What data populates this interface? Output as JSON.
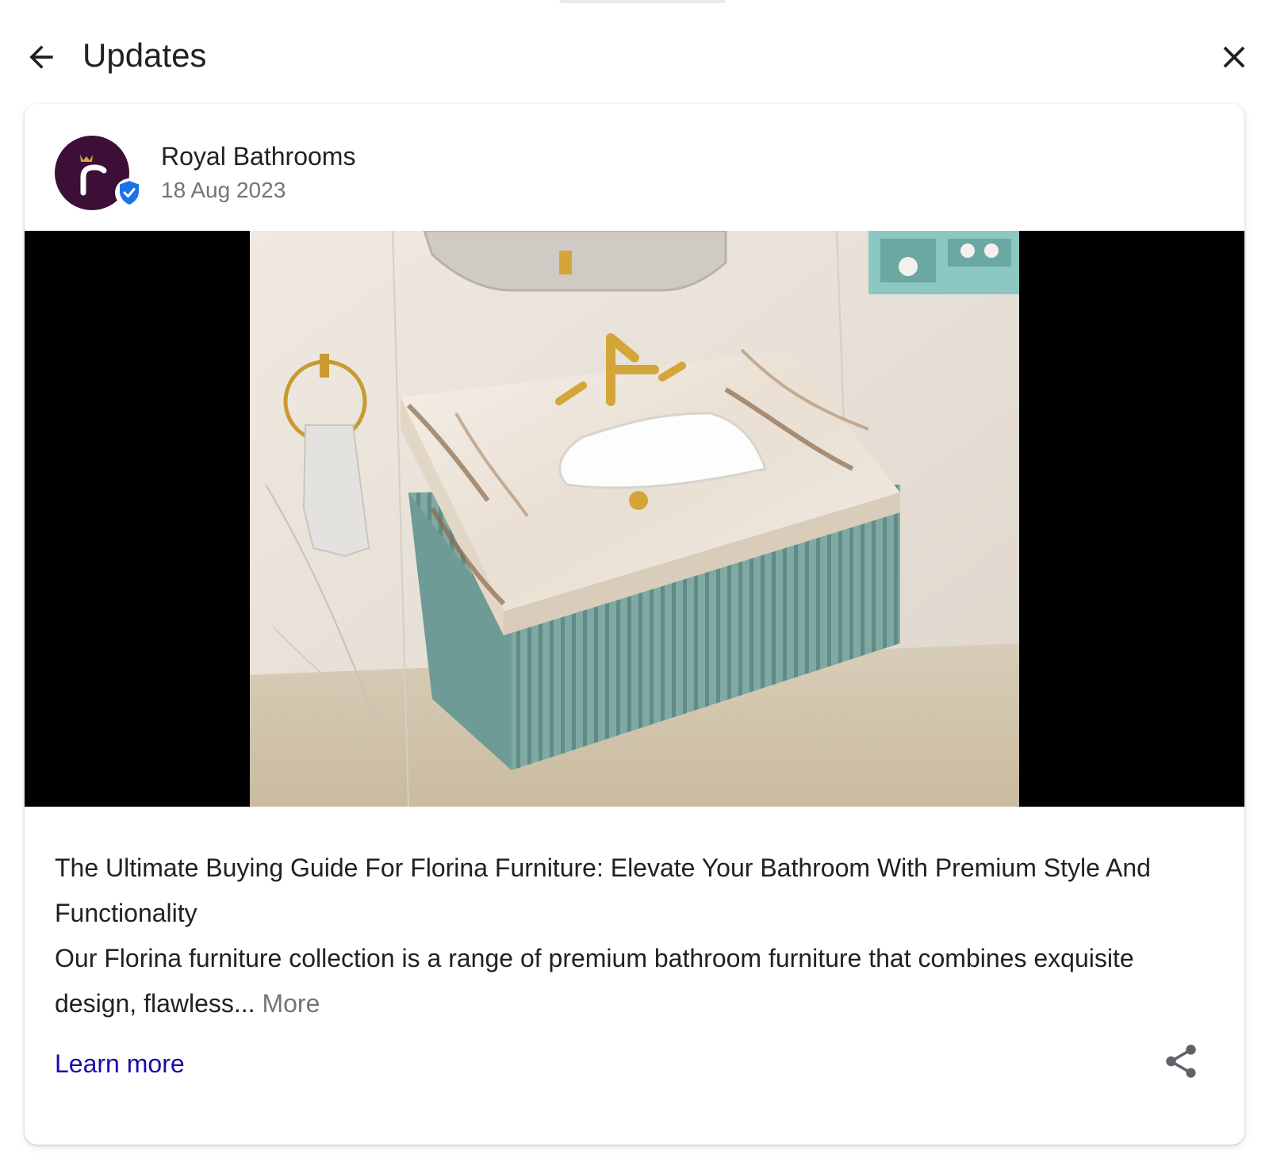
{
  "header": {
    "title": "Updates",
    "back_icon": "arrow-back-icon",
    "close_icon": "close-icon"
  },
  "post": {
    "author": "Royal Bathrooms",
    "date": "18 Aug 2023",
    "verified_icon": "verified-badge-icon",
    "title": "The Ultimate Buying Guide For Florina Furniture: Elevate Your Bathroom With Premium Style And Functionality",
    "body": "Our Florina furniture collection is a range of premium bathroom furniture that combines exquisite design, flawless...",
    "more_label": "More",
    "learn_more_label": "Learn more",
    "share_icon": "share-icon"
  },
  "colors": {
    "avatar_bg": "#3d0f37",
    "link": "#1a0dab",
    "verified": "#1a73e8",
    "secondary_text": "#70757a"
  }
}
